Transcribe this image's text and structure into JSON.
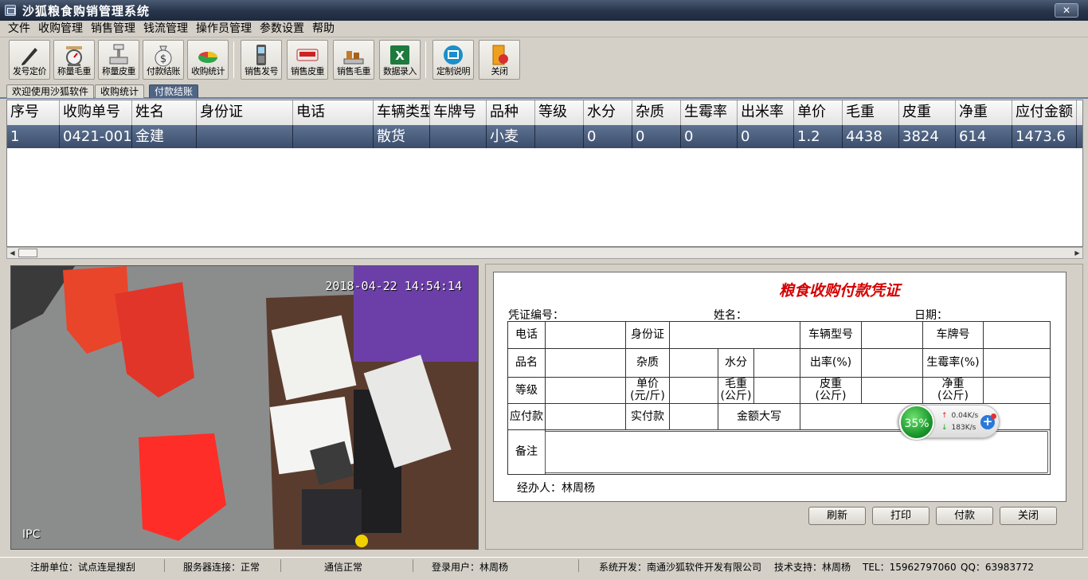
{
  "window": {
    "title": "沙狐粮食购销管理系统",
    "close": "✕"
  },
  "menu": [
    "文件",
    "收购管理",
    "销售管理",
    "钱流管理",
    "操作员管理",
    "参数设置",
    "帮助"
  ],
  "toolbar": [
    {
      "label": "发号定价",
      "icon": "pen-icon"
    },
    {
      "label": "称量毛重",
      "icon": "scale-icon"
    },
    {
      "label": "称量皮重",
      "icon": "platform-scale-icon"
    },
    {
      "label": "付款结账",
      "icon": "money-bag-icon"
    },
    {
      "label": "收购统计",
      "icon": "pie-chart-icon"
    },
    {
      "label": "销售发号",
      "icon": "handheld-icon"
    },
    {
      "label": "销售皮重",
      "icon": "weight-display-icon"
    },
    {
      "label": "销售毛重",
      "icon": "cargo-scale-icon"
    },
    {
      "label": "数据录入",
      "icon": "excel-icon"
    },
    {
      "label": "定制说明",
      "icon": "info-icon"
    },
    {
      "label": "关闭",
      "icon": "exit-icon"
    }
  ],
  "tabs": [
    {
      "label": "欢迎使用沙狐软件",
      "active": false
    },
    {
      "label": "收购统计",
      "active": false
    },
    {
      "label": "付款结账",
      "active": true
    }
  ],
  "grid": {
    "columns": [
      "序号",
      "收购单号",
      "姓名",
      "身份证",
      "电话",
      "车辆类型",
      "车牌号",
      "品种",
      "等级",
      "水分",
      "杂质",
      "生霉率",
      "出米率",
      "单价",
      "毛重",
      "皮重",
      "净重",
      "应付金额"
    ],
    "rows": [
      [
        "1",
        "0421-001",
        "金建",
        "",
        "",
        "散货",
        "",
        "小麦",
        "",
        "0",
        "0",
        "0",
        "0",
        "1.2",
        "4438",
        "3824",
        "614",
        "1473.6"
      ]
    ]
  },
  "camera": {
    "timestamp": "2018-04-22 14:54:14",
    "label": "IPC"
  },
  "voucher": {
    "title": "粮食收购付款凭证",
    "voucher_no_label": "凭证编号：",
    "name_label": "姓名：",
    "date_label": "日期：",
    "fields": {
      "phone": "电话",
      "id_card": "身份证",
      "vehicle_type": "车辆型号",
      "plate": "车牌号",
      "product": "品名",
      "impurity": "杂质",
      "moisture": "水分",
      "yield_rate": "出率(%)",
      "mold_rate": "生霉率(%)",
      "grade": "等级",
      "unit_price_1": "单价",
      "unit_price_2": "(元/斤)",
      "gross_1": "毛重",
      "gross_2": "(公斤)",
      "tare_1": "皮重",
      "tare_2": "(公斤)",
      "net_1": "净重",
      "net_2": "(公斤)",
      "payable": "应付款",
      "paid": "实付款",
      "amount_words": "金额大写",
      "remark": "备注"
    },
    "agent": "经办人：林周杨"
  },
  "buttons": {
    "refresh": "刷新",
    "print": "打印",
    "pay": "付款",
    "close": "关闭"
  },
  "net_widget": {
    "percent": "35%",
    "up": "0.04K/s",
    "down": "183K/s",
    "plus": "+"
  },
  "status": {
    "unit": "注册单位：试点连是搜刮",
    "server": "服务器连接：正常",
    "comm": "通信正常",
    "user": "登录用户：林周杨",
    "developer": "系统开发：南通沙狐软件开发有限公司",
    "support": "技术支持：林周杨",
    "tel": "TEL：15962797060",
    "qq": "QQ：63983772"
  }
}
